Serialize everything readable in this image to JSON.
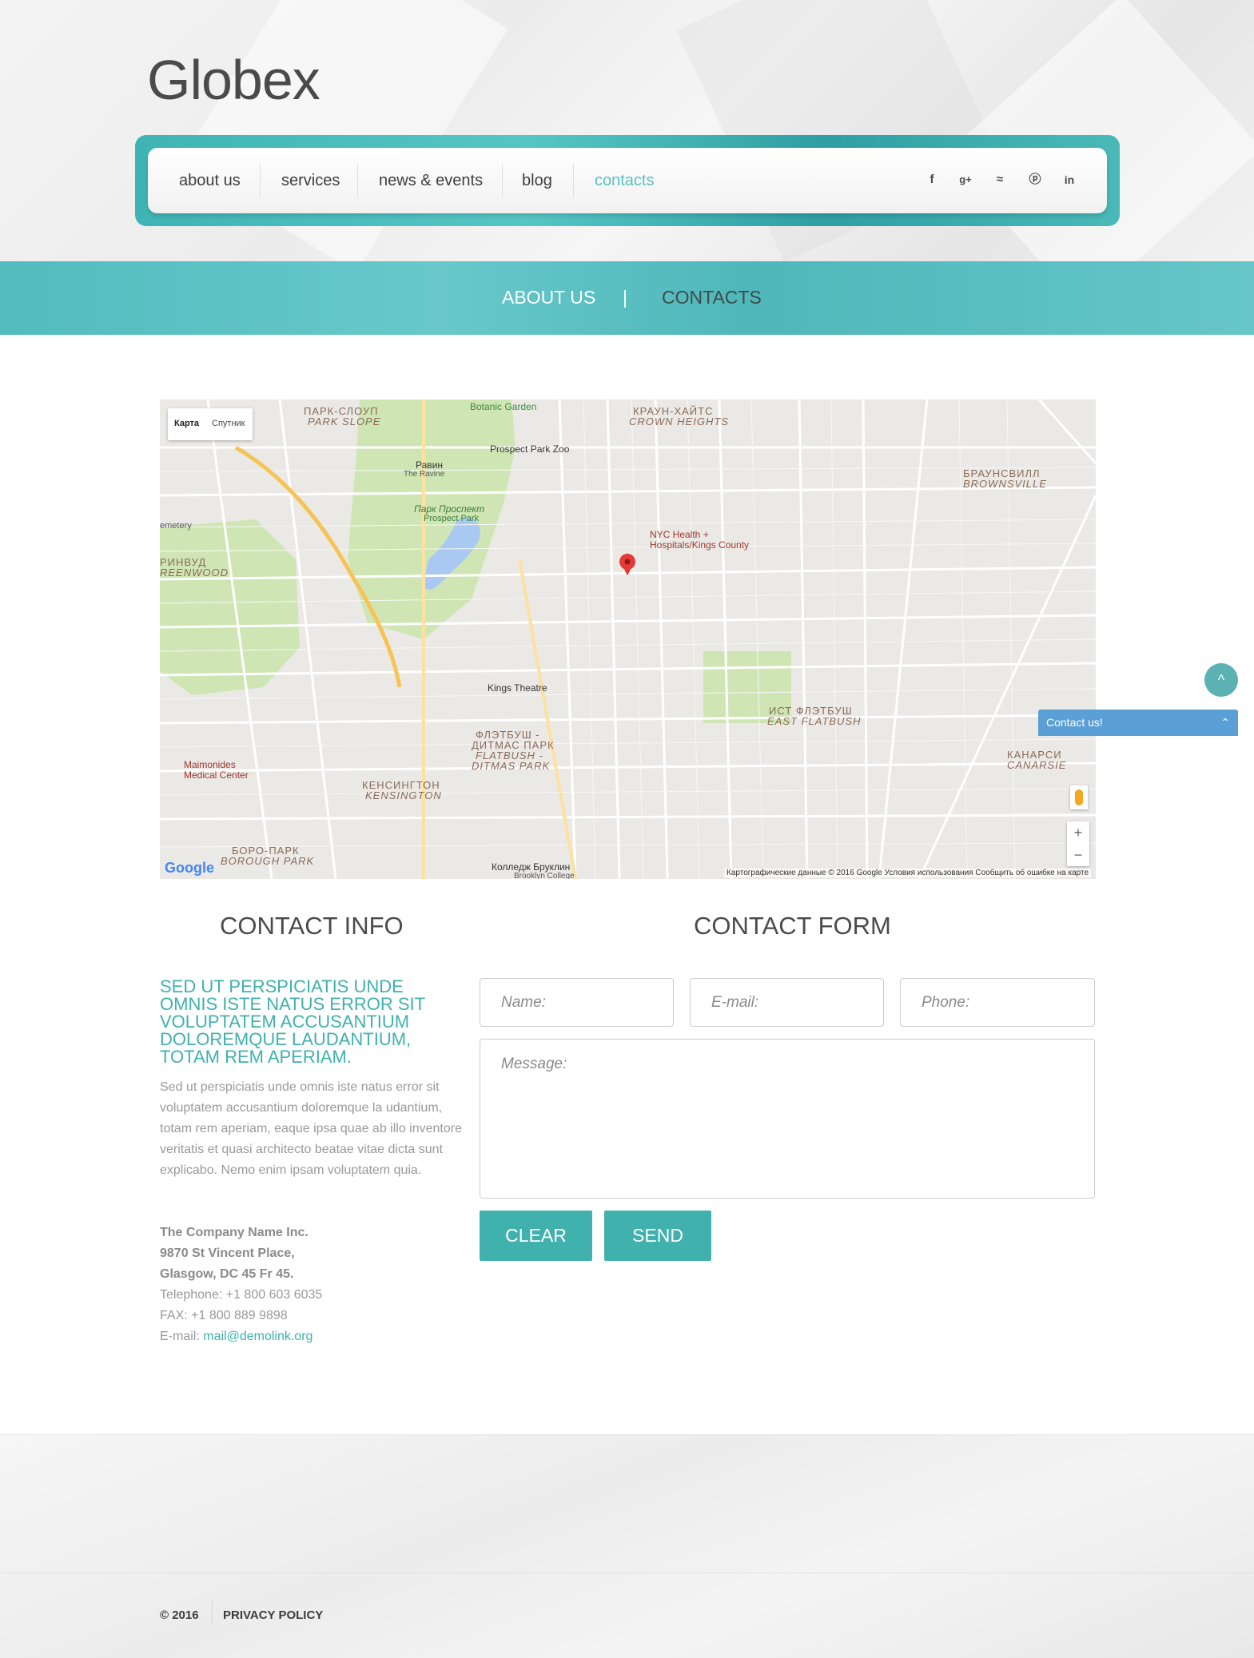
{
  "header": {
    "logo": "Globex",
    "nav": [
      {
        "label": "about us"
      },
      {
        "label": "services"
      },
      {
        "label": "news & events"
      },
      {
        "label": "blog"
      },
      {
        "label": "contacts",
        "active": true
      }
    ],
    "social": [
      {
        "icon": "facebook-icon",
        "glyph": "f"
      },
      {
        "icon": "google-plus-icon",
        "glyph": "g+"
      },
      {
        "icon": "rss-icon",
        "glyph": "≈"
      },
      {
        "icon": "pinterest-icon",
        "glyph": "ⓟ"
      },
      {
        "icon": "linkedin-icon",
        "glyph": "in"
      }
    ]
  },
  "breadcrumb": {
    "parent": "ABOUT US",
    "separator": "|",
    "current": "CONTACTS"
  },
  "map": {
    "type_buttons": [
      "Карта",
      "Спутник"
    ],
    "labels": {
      "park_slope_ru": "ПАРК-СЛОУП",
      "park_slope": "PARK SLOPE",
      "crown_heights_ru": "КРАУН-ХАЙТС",
      "crown_heights": "CROWN HEIGHTS",
      "brownsville_ru": "БРАУНСВИЛЛ",
      "brownsville": "BROWNSVILLE",
      "botanic": "Botanic Garden",
      "zoo": "Prospect Park Zoo",
      "ravine": "Равин",
      "ravine_en": "The Ravine",
      "prospect_park_ru": "Парк Проспект",
      "prospect_park": "Prospect Park",
      "nyc_health": "NYC Health +",
      "nyc_health2": "Hospitals/Kings County",
      "kings_theatre": "Kings Theatre",
      "flatbush_ru": "ФЛЭТБУШ -",
      "flatbush_ru2": "ДИТМАС ПАРК",
      "flatbush": "FLATBUSH -",
      "flatbush2": "DITMAS PARK",
      "east_flatbush_ru": "ИСТ ФЛЭТБУШ",
      "east_flatbush": "EAST FLATBUSH",
      "kensington_ru": "КЕНСИНГТОН",
      "kensington": "KENSINGTON",
      "borough_park_ru": "БОРО-ПАРК",
      "borough_park": "BOROUGH PARK",
      "canarsie_ru": "КАНАРСИ",
      "canarsie": "CANARSIE",
      "greenwood_ru": "РИНВУД",
      "greenwood": "REENWOOD",
      "cemetery": "emetery",
      "maimonides": "Maimonides",
      "maimonides2": "Medical Center",
      "brooklyn_college": "Колледж Бруклин",
      "brooklyn_college2": "Brooklyn College"
    },
    "google": "Google",
    "attribution": "Картографические данные © 2016 Google   Условия использования   Сообщить об ошибке на карте",
    "zoom_in": "+",
    "zoom_out": "−"
  },
  "contact_info": {
    "title": "CONTACT INFO",
    "heading": "SED UT PERSPICIATIS UNDE OMNIS ISTE NATUS ERROR SIT VOLUPTATEM ACCUSANTIUM DOLOREMQUE LAUDANTIUM, TOTAM REM APERIAM.",
    "body": "Sed ut perspiciatis unde omnis iste natus error sit voluptatem accusantium doloremque la udantium, totam rem aperiam, eaque ipsa quae ab illo inventore veritatis et quasi architecto beatae vitae dicta sunt explicabo. Nemo enim ipsam voluptatem quia.",
    "company": "The Company Name Inc.",
    "street": "9870 St Vincent Place,",
    "city": "Glasgow, DC 45 Fr 45.",
    "telephone": "Telephone: +1 800 603 6035",
    "fax": "FAX: +1 800 889 9898",
    "email_label": "E-mail: ",
    "email": "mail@demolink.org"
  },
  "contact_form": {
    "title": "CONTACT FORM",
    "name_placeholder": "Name:",
    "email_placeholder": "E-mail:",
    "phone_placeholder": "Phone:",
    "message_placeholder": "Message:",
    "clear": "CLEAR",
    "send": "SEND"
  },
  "widgets": {
    "to_top": "^",
    "contact_us": "Contact us!"
  },
  "footer": {
    "copyright": "© 2016",
    "privacy": "PRIVACY POLICY"
  },
  "colors": {
    "accent": "#40b1ad",
    "nav_active": "#5bbfc1",
    "contact_widget": "#5a9fd6"
  }
}
